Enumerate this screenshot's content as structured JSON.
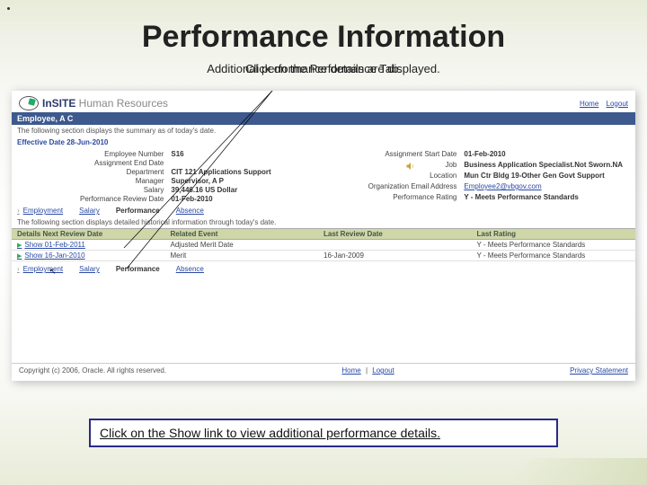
{
  "slide": {
    "title": "Performance Information",
    "subtitle_back": "Additional performance details are displayed.",
    "subtitle_front": "Click on the Performance Tab.",
    "callout": "Click on the Show link to view additional performance details."
  },
  "app": {
    "logo_main": "InSITE",
    "logo_sub": "    Human Resources",
    "header_links": {
      "home": "Home",
      "logout": "Logout"
    },
    "employee_bar": "Employee, A C",
    "summary_note": "The following section displays the summary as of today's date.",
    "effective_date_label": "Effective Date 28-Jun-2010",
    "left_fields": {
      "emp_no_lab": "Employee Number",
      "emp_no_val": "S16",
      "assign_end_lab": "Assignment End Date",
      "assign_end_val": "",
      "dept_lab": "Department",
      "dept_val": "CIT 121 Applications Support",
      "mgr_lab": "Manager",
      "mgr_val": "Supervisor, A P",
      "salary_lab": "Salary",
      "salary_val": "39,446.16 US Dollar",
      "perf_date_lab": "Performance Review Date",
      "perf_date_val": "01-Feb-2010"
    },
    "right_fields": {
      "assign_start_lab": "Assignment Start Date",
      "assign_start_val": "01-Feb-2010",
      "job_lab": "Job",
      "job_val": "Business Application Specialist.Not Sworn.NA",
      "loc_lab": "Location",
      "loc_val": "Mun Ctr Bldg 19-Other Gen Govt Support",
      "email_lab": "Organization Email Address",
      "email_val": "Employee2@vbgov.com",
      "rating_lab": "Performance Rating",
      "rating_val": "Y - Meets Performance Standards"
    },
    "tabs": {
      "t1": "Employment",
      "t2": "Salary",
      "t3": "Performance",
      "t4": "Absence"
    },
    "history_note": "The following section displays detailed historical information through today's date.",
    "table": {
      "h1": "Details Next Review Date",
      "h2": "Related Event",
      "h3": "Last Review Date",
      "h4": "Last Rating",
      "rows": [
        {
          "show": "Show 01-Feb-2011",
          "event": "Adjusted Merit Date",
          "review": "",
          "rating": "Y - Meets Performance Standards"
        },
        {
          "show": "Show 16-Jan-2010",
          "event": "Merit",
          "review": "16-Jan-2009",
          "rating": "Y - Meets Performance Standards"
        }
      ]
    },
    "footer": {
      "copyright": "Copyright (c) 2006, Oracle. All rights reserved.",
      "home": "Home",
      "logout": "Logout",
      "privacy": "Privacy Statement"
    }
  }
}
